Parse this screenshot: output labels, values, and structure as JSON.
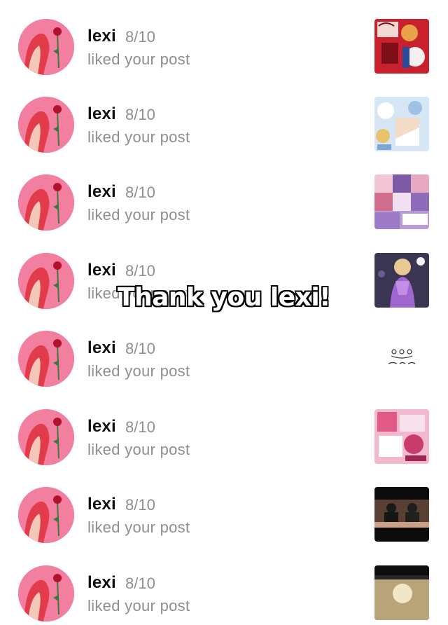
{
  "notifications": [
    {
      "username": "lexi",
      "score": "8/10",
      "action": "liked your post",
      "thumbnail": "red-collage"
    },
    {
      "username": "lexi",
      "score": "8/10",
      "action": "liked your post",
      "thumbnail": "blue-collage"
    },
    {
      "username": "lexi",
      "score": "8/10",
      "action": "liked your post",
      "thumbnail": "purple-collage"
    },
    {
      "username": "lexi",
      "score": "8/10",
      "action": "liked your post",
      "thumbnail": "purple-dress-photo"
    },
    {
      "username": "lexi",
      "score": "8/10",
      "action": "liked your post",
      "thumbnail": "white-sketch"
    },
    {
      "username": "lexi",
      "score": "8/10",
      "action": "liked your post",
      "thumbnail": "pink-collage"
    },
    {
      "username": "lexi",
      "score": "8/10",
      "action": "liked your post",
      "thumbnail": "dark-video-still"
    },
    {
      "username": "lexi",
      "score": "8/10",
      "action": "liked your post",
      "thumbnail": "dark-photo"
    }
  ],
  "overlay": {
    "caption": "Thank you lexi!"
  },
  "colors": {
    "username": "#111111",
    "secondary_text": "#8e8e8e",
    "avatar_bg": "#f27fa0"
  }
}
